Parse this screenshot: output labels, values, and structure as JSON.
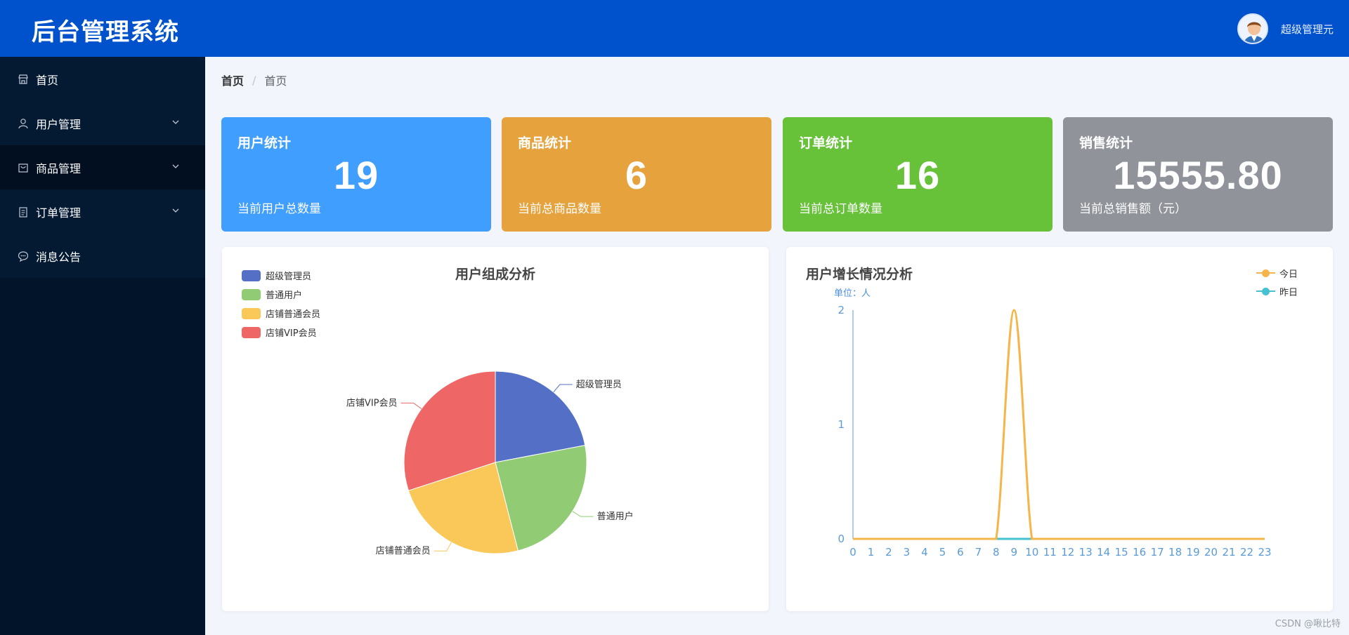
{
  "app": {
    "title": "后台管理系统"
  },
  "header": {
    "user_name": "超级管理元"
  },
  "sidebar": {
    "items": [
      {
        "label": "首页",
        "icon": "store-icon",
        "has_children": false
      },
      {
        "label": "用户管理",
        "icon": "user-icon",
        "has_children": true
      },
      {
        "label": "商品管理",
        "icon": "box-icon",
        "has_children": true
      },
      {
        "label": "订单管理",
        "icon": "clipboard-icon",
        "has_children": true
      },
      {
        "label": "消息公告",
        "icon": "chat-icon",
        "has_children": false
      }
    ]
  },
  "breadcrumb": {
    "root": "首页",
    "separator": "/",
    "current": "首页"
  },
  "stats": [
    {
      "title": "用户统计",
      "value": "19",
      "desc": "当前用户总数量",
      "color": "#409eff"
    },
    {
      "title": "商品统计",
      "value": "6",
      "desc": "当前总商品数量",
      "color": "#e6a23c"
    },
    {
      "title": "订单统计",
      "value": "16",
      "desc": "当前总订单数量",
      "color": "#67c23a"
    },
    {
      "title": "销售统计",
      "value": "15555.80",
      "desc": "当前总销售额（元）",
      "color": "#909399"
    }
  ],
  "chart_data": [
    {
      "type": "pie",
      "title": "用户组成分析",
      "legend_position": "top-left",
      "categories": [
        "超级管理员",
        "普通用户",
        "店铺普通会员",
        "店铺VIP会员"
      ],
      "values": [
        22,
        24,
        24,
        30
      ],
      "colors": [
        "#5470c6",
        "#91cc75",
        "#fac858",
        "#ee6666"
      ]
    },
    {
      "type": "line",
      "title": "用户增长情况分析",
      "unit_label": "单位：人",
      "legend_position": "top-right",
      "x": [
        "0",
        "1",
        "2",
        "3",
        "4",
        "5",
        "6",
        "7",
        "8",
        "9",
        "10",
        "11",
        "12",
        "13",
        "14",
        "15",
        "16",
        "17",
        "18",
        "19",
        "20",
        "21",
        "22",
        "23"
      ],
      "ylim": [
        0,
        2
      ],
      "yticks": [
        "0",
        "1",
        "2"
      ],
      "series": [
        {
          "name": "今日",
          "color": "#f5b54a",
          "values": [
            0,
            0,
            0,
            0,
            0,
            0,
            0,
            0,
            0,
            2,
            0,
            0,
            0,
            0,
            0,
            0,
            0,
            0,
            0,
            0,
            0,
            0,
            0,
            0
          ]
        },
        {
          "name": "昨日",
          "color": "#45c1d1",
          "values": [
            0,
            0,
            0,
            0,
            0,
            0,
            0,
            0,
            0,
            0,
            0,
            0,
            0,
            0,
            0,
            0,
            0,
            0,
            0,
            0,
            0,
            0,
            0,
            0
          ]
        }
      ]
    }
  ],
  "watermark": "CSDN @啾比特"
}
